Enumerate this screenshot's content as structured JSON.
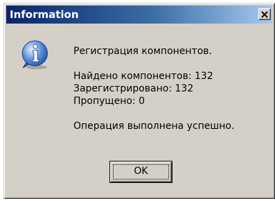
{
  "window": {
    "title": "Information"
  },
  "icons": {
    "close": "close-icon",
    "info": "information-icon"
  },
  "message": {
    "heading": "Регистрация компонентов.",
    "found": "Найдено компонентов: 132",
    "registered": "Зарегистрировано: 132",
    "skipped": "Пропущено: 0",
    "result": "Операция выполнена успешно."
  },
  "buttons": {
    "ok_label": "OK"
  },
  "colors": {
    "title_bar_start": "#0a246a",
    "title_bar_end": "#a6caf0",
    "dialog_face": "#d4d0c8"
  }
}
